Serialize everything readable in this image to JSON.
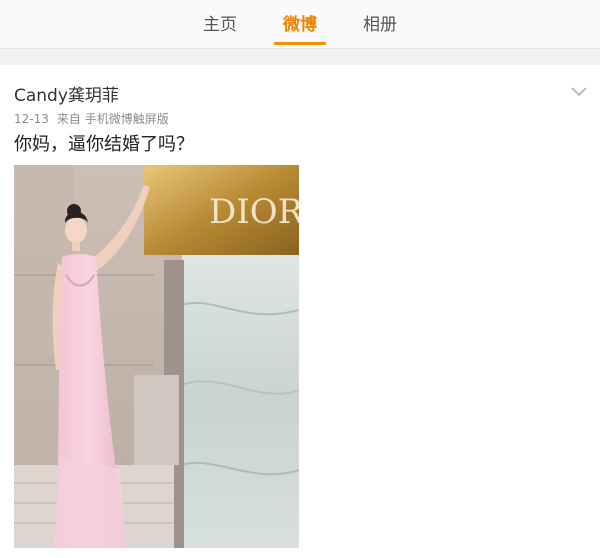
{
  "tabs": [
    {
      "label": "主页",
      "active": false
    },
    {
      "label": "微博",
      "active": true
    },
    {
      "label": "相册",
      "active": false
    }
  ],
  "accent_color": "#f29100",
  "post": {
    "author": "Candy龚玥菲",
    "date": "12-13",
    "source": "来自 手机微博触屏版",
    "text": "你妈，逼你结婚了吗？",
    "image": {
      "description_icon": "photo",
      "sign_text": "DIOR"
    }
  }
}
